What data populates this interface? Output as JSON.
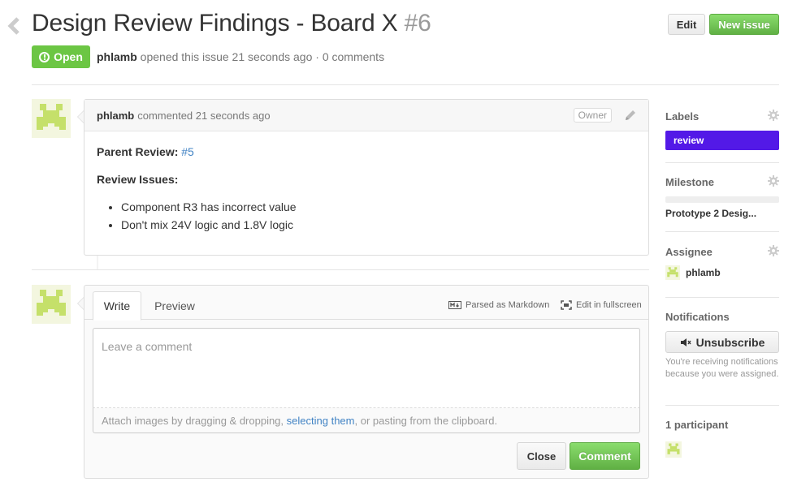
{
  "issue": {
    "title": "Design Review Findings - Board X",
    "number": "#6",
    "state": "Open",
    "author": "phlamb",
    "opened_text": "opened this issue 21 seconds ago · 0 comments"
  },
  "header": {
    "edit_label": "Edit",
    "new_issue_label": "New issue"
  },
  "comment": {
    "author": "phlamb",
    "time_text": "commented 21 seconds ago",
    "owner_label": "Owner",
    "parent_review_label": "Parent Review:",
    "parent_review_link": "#5",
    "review_issues_label": "Review Issues:",
    "items": [
      "Component R3 has incorrect value",
      "Don't mix 24V logic and 1.8V logic"
    ]
  },
  "editor": {
    "write_tab": "Write",
    "preview_tab": "Preview",
    "markdown_note": "Parsed as Markdown",
    "fullscreen_label": "Edit in fullscreen",
    "placeholder": "Leave a comment",
    "attach_prefix": "Attach images by dragging & dropping,",
    "attach_link": "selecting them",
    "attach_suffix": ", or pasting from the clipboard.",
    "close_label": "Close",
    "comment_label": "Comment"
  },
  "sidebar": {
    "labels_heading": "Labels",
    "label_name": "review",
    "label_color": "#5319e7",
    "milestone_heading": "Milestone",
    "milestone_progress": 0,
    "milestone_title": "Prototype 2 Desig...",
    "assignee_heading": "Assignee",
    "assignee_name": "phlamb",
    "notifications_heading": "Notifications",
    "unsubscribe_label": "Unsubscribe",
    "notifications_text": "You're receiving notifications because you were assigned.",
    "participants_heading": "1 participant"
  },
  "colors": {
    "open_green": "#6cc644",
    "link_blue": "#4183c4",
    "avatar_green": "#c5e06a"
  }
}
